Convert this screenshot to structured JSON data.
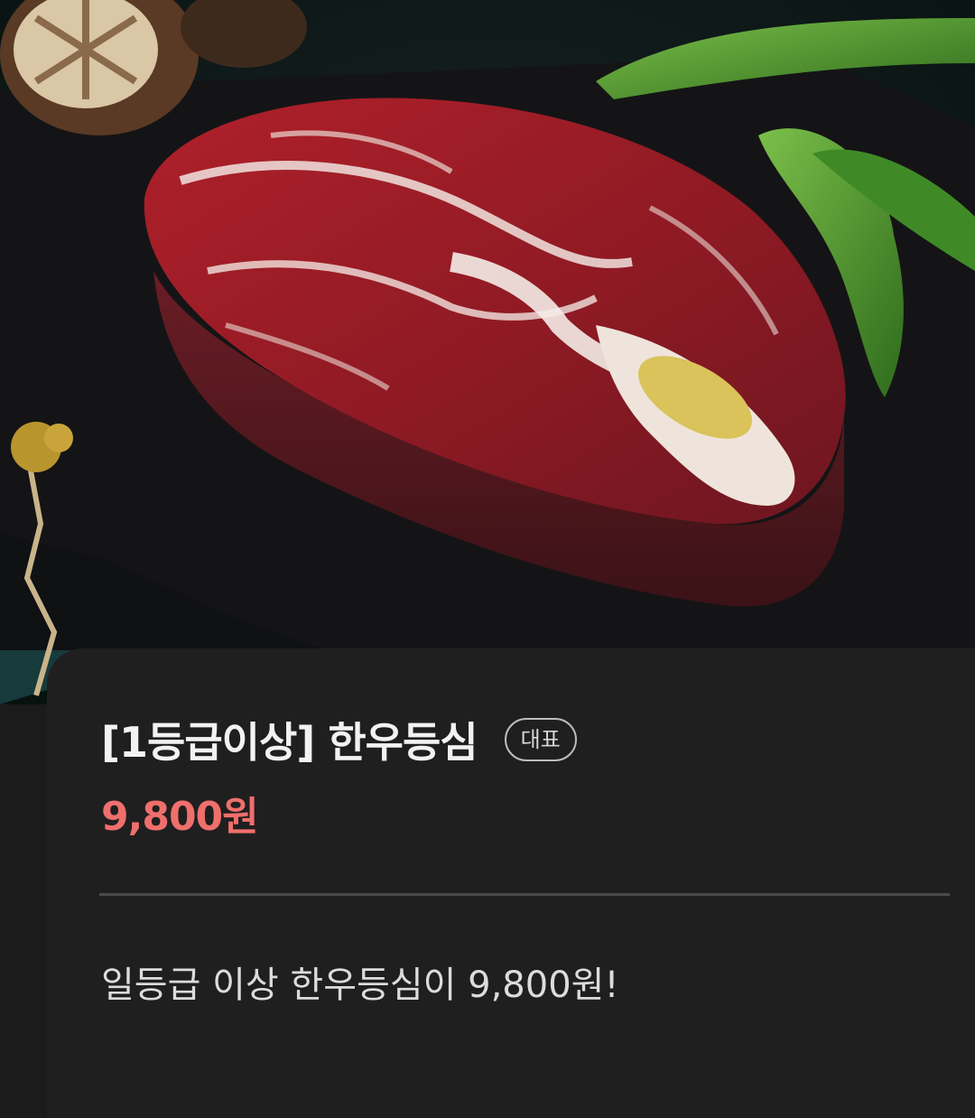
{
  "product": {
    "title": "[1등급이상] 한우등심",
    "badge": "대표",
    "price": "9,800원",
    "description": "일등급 이상 한우등심이 9,800원!"
  },
  "colors": {
    "price": "#ef6f6c",
    "card_background": "#1f1f1f",
    "page_background": "#1b1b1b"
  }
}
